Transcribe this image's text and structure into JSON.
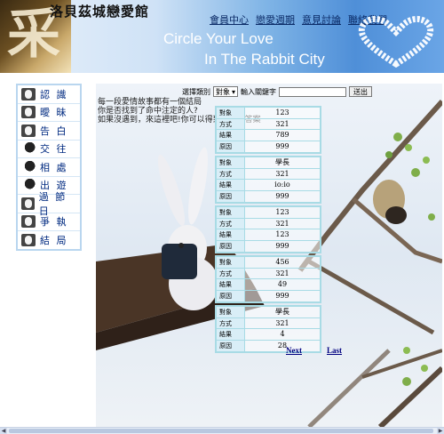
{
  "header": {
    "logo_glyph": "采",
    "site_title": "洛貝茲城戀愛館",
    "top_nav": [
      "會員中心",
      "戀愛週期",
      "意見討論",
      "聯絡我們"
    ],
    "slogan_line1": "Circle Your Love",
    "slogan_line2": "In The Rabbit City"
  },
  "sidebar": {
    "items": [
      {
        "label": "認 識",
        "icon": "bunny-icon"
      },
      {
        "label": "曖 昧",
        "icon": "bunny-icon"
      },
      {
        "label": "告 白",
        "icon": "bunny-icon"
      },
      {
        "label": "交 往",
        "icon": "bird-icon"
      },
      {
        "label": "相 處",
        "icon": "bird-icon"
      },
      {
        "label": "出 遊",
        "icon": "bird-icon"
      },
      {
        "label": "過 節 日",
        "icon": "bunny-icon"
      },
      {
        "label": "爭 執",
        "icon": "bunny-icon"
      },
      {
        "label": "結 局",
        "icon": "bunny-icon"
      }
    ]
  },
  "intro": {
    "lines": [
      "每一段愛情故事都有一個結局",
      "你是否找到了命中注定的人?",
      "如果沒遇到，來這裡吧!你可以得到你要的答案"
    ]
  },
  "search": {
    "category_label": "選擇類別",
    "category_value": "對象",
    "keyword_label": "輸入關鍵字",
    "keyword_value": "",
    "button_label": "送出"
  },
  "records": [
    {
      "rows": [
        {
          "key": "對象",
          "value": "123"
        },
        {
          "key": "方式",
          "value": "321"
        },
        {
          "key": "結果",
          "value": "789"
        },
        {
          "key": "原因",
          "value": "999"
        }
      ]
    },
    {
      "rows": [
        {
          "key": "對象",
          "value": "學長"
        },
        {
          "key": "方式",
          "value": "321"
        },
        {
          "key": "結果",
          "value": "io:io"
        },
        {
          "key": "原因",
          "value": "999"
        }
      ]
    },
    {
      "rows": [
        {
          "key": "對象",
          "value": "123"
        },
        {
          "key": "方式",
          "value": "321"
        },
        {
          "key": "結果",
          "value": "123"
        },
        {
          "key": "原因",
          "value": "999"
        }
      ]
    },
    {
      "rows": [
        {
          "key": "對象",
          "value": "456"
        },
        {
          "key": "方式",
          "value": "321"
        },
        {
          "key": "結果",
          "value": "49"
        },
        {
          "key": "原因",
          "value": "999"
        }
      ]
    },
    {
      "rows": [
        {
          "key": "對象",
          "value": "學長"
        },
        {
          "key": "方式",
          "value": "321"
        },
        {
          "key": "結果",
          "value": "4"
        },
        {
          "key": "原因",
          "value": "28"
        }
      ]
    }
  ],
  "pager": {
    "next_label": "Next",
    "last_label": "Last"
  },
  "colors": {
    "accent": "#4f8fd8",
    "record_border": "#a8dbe5",
    "link": "#000080",
    "sidebar_text": "#002a80"
  }
}
